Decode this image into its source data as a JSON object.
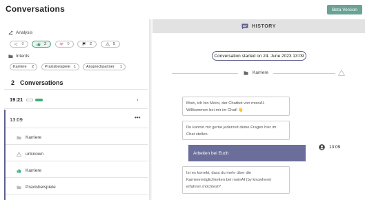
{
  "header": {
    "title": "Conversations",
    "beta_button": "Beta Version"
  },
  "analysis": {
    "label": "Analysis",
    "filters": [
      {
        "icon": "share-icon",
        "count": "0",
        "selected": false
      },
      {
        "icon": "thumbs-up-icon",
        "count": "2",
        "selected": true
      },
      {
        "icon": "heart-icon",
        "count": "0",
        "selected": false
      },
      {
        "icon": "flag-icon",
        "count": "2",
        "selected": false
      },
      {
        "icon": "warning-icon",
        "count": "5",
        "selected": false
      }
    ]
  },
  "intents": {
    "label": "Intents",
    "items": [
      {
        "name": "Karriere",
        "count": "2"
      },
      {
        "name": "Praxisbeispiele",
        "count": "1"
      },
      {
        "name": "Ansprechpartner",
        "count": "1"
      }
    ]
  },
  "conversations": {
    "count": "2",
    "label": "Conversations",
    "items": [
      {
        "time": "19:21",
        "expanded": false
      },
      {
        "time": "13:09",
        "expanded": true,
        "events": [
          {
            "icon": "folder-icon",
            "label": "Karriere"
          },
          {
            "icon": "warning-icon",
            "label": "unknown"
          },
          {
            "icon": "thumbs-up-icon",
            "label": "Karriere"
          },
          {
            "icon": "folder-icon",
            "label": "Praxisbeispiele"
          }
        ]
      }
    ]
  },
  "history": {
    "tab_label": "HISTORY",
    "started": "Conversation started on 24. June 2023 13:09",
    "topic": "Karriere",
    "messages": [
      {
        "from": "bot",
        "line1": "Moin, ich bin Moini, der Chatbot von moinAI.",
        "line2": "Willkommen bei mir im Chat! 👋"
      },
      {
        "from": "bot",
        "line1": "Du kannst mir gerne jederzeit deine Fragen hier im",
        "line2": "Chat stellen."
      },
      {
        "from": "user",
        "text": "Arbeiten bei Euch",
        "time": "13:09"
      },
      {
        "from": "bot",
        "line1": "Ist es korrekt, dass du mehr über die",
        "line2": "Karrieremöglichkeiten bei moinAI (by knowhere)",
        "line3": "erfahren möchtest?"
      }
    ]
  },
  "colors": {
    "accent": "#5c5f8a",
    "beta": "#6aa395",
    "positive": "#3cae7a",
    "user_bubble": "#6b6e9a"
  }
}
